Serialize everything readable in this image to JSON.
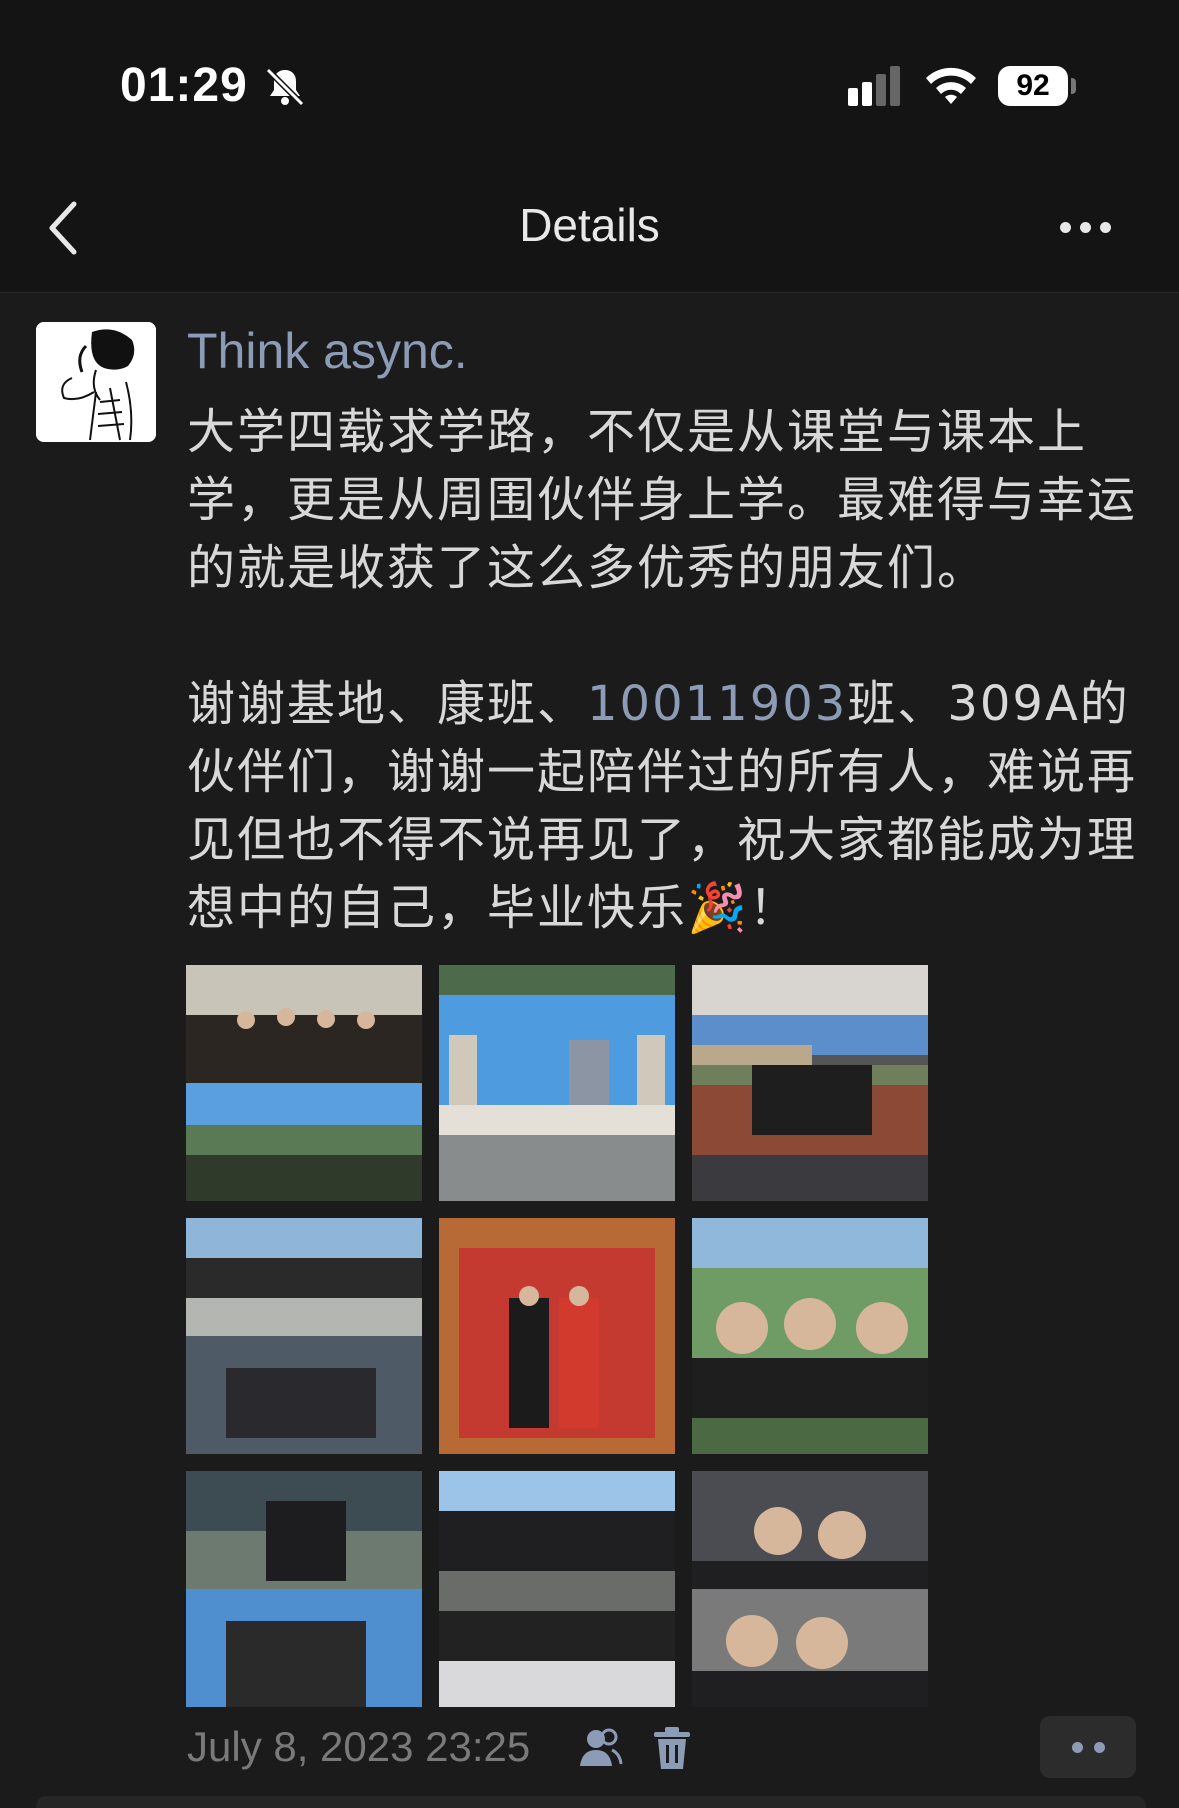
{
  "status_bar": {
    "time": "01:29",
    "battery": "92"
  },
  "nav": {
    "title": "Details"
  },
  "post": {
    "author": "Think async.",
    "text_part1": "大学四载求学路，不仅是从课堂与课本上学，更是从周围伙伴身上学。最难得与幸运的就是收获了这么多优秀的朋友们。\n\n谢谢基地、康班、",
    "class_link": "10011903",
    "text_part2": "班、309A的伙伴们，谢谢一起陪伴过的所有人，难说再见但也不得不说再见了，祝大家都能成为理想中的自己，毕业快乐🎉！",
    "photo_count": 9,
    "timestamp": "July 8, 2023 23:25"
  }
}
